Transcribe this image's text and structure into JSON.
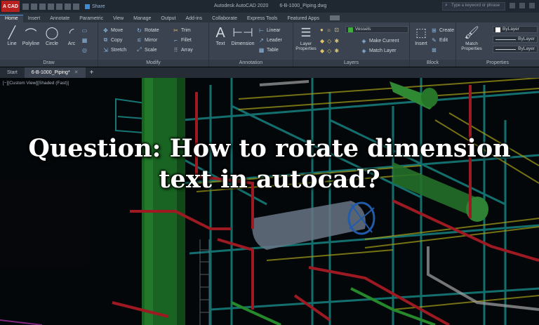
{
  "titlebar": {
    "logo": "A CAD",
    "share_label": "Share",
    "app_title": "Autodesk AutoCAD 2020",
    "file_title": "6-B-1000_Piping.dwg",
    "search_placeholder": "Type a keyword or phrase"
  },
  "tabs": [
    "Home",
    "Insert",
    "Annotate",
    "Parametric",
    "View",
    "Manage",
    "Output",
    "Add-ins",
    "Collaborate",
    "Express Tools",
    "Featured Apps"
  ],
  "ribbon": {
    "draw": {
      "title": "Draw",
      "line": "Line",
      "polyline": "Polyline",
      "circle": "Circle",
      "arc": "Arc"
    },
    "modify": {
      "title": "Modify",
      "move": "Move",
      "rotate": "Rotate",
      "trim": "Trim",
      "copy": "Copy",
      "mirror": "Mirror",
      "fillet": "Fillet",
      "stretch": "Stretch",
      "scale": "Scale",
      "array": "Array"
    },
    "annotation": {
      "title": "Annotation",
      "text": "Text",
      "dimension": "Dimension",
      "linear": "Linear",
      "leader": "Leader",
      "table": "Table"
    },
    "layers": {
      "title": "Layers",
      "layer_properties": "Layer Properties",
      "current_layer": "Vessels",
      "make_current": "Make Current",
      "match_layer": "Match Layer",
      "layer_color": "#3fae3f"
    },
    "block": {
      "title": "Block",
      "insert": "Insert",
      "create": "Create",
      "edit": "Edit"
    },
    "properties": {
      "title": "Properties",
      "match": "Match Properties",
      "color": "ByLayer",
      "linetype": "ByLayer",
      "lineweight": "ByLayer"
    }
  },
  "doc_tabs": {
    "start": "Start",
    "active": "6-B-1000_Piping*"
  },
  "viewport": {
    "label": "[−][Custom View][Shaded (Fast)]"
  },
  "headline": {
    "line1": "Question: How to rotate dimension",
    "line2": "text in autocad?"
  }
}
